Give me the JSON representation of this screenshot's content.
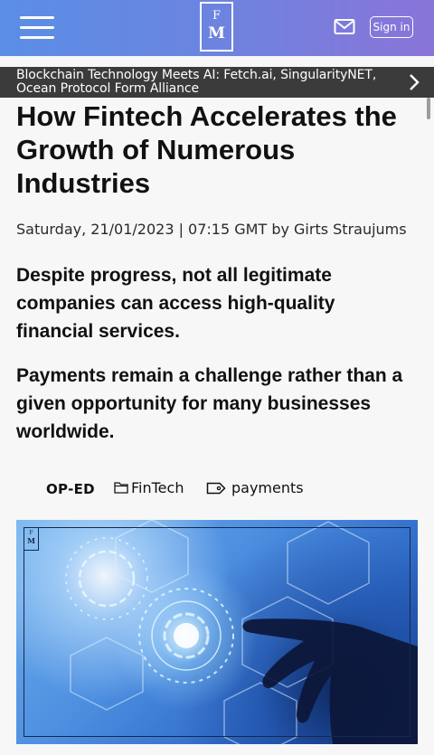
{
  "header": {
    "logo_top": "F",
    "logo_bottom": "M",
    "menu_icon": "hamburger-menu-icon",
    "mail_icon": "mail-icon",
    "signin_label": "Sign in",
    "gradient_colors": [
      "#5b8ee6",
      "#8a74d8"
    ]
  },
  "ticker": {
    "line1": "Blockchain Technology Meets AI: Fetch.ai, SingularityNET,",
    "line2": "Ocean Protocol Form Alliance",
    "chevron_icon": "chevron-right-icon",
    "background": "#3b3b3b"
  },
  "article": {
    "title": "How Fintech Accelerates the Growth of Numerous Industries",
    "byline": "Saturday, 21/01/2023 | 07:15 GMT by Girts Straujums",
    "lead1": "Despite progress, not all legitimate companies can access high-quality financial services.",
    "lead2": "Payments remain a challenge rather than a given opportunity for many businesses worldwide."
  },
  "tags": {
    "category": "OP-ED",
    "folder_icon": "folder-icon",
    "section": "FinTech",
    "tag_icon": "tag-icon",
    "keyword": "payments"
  },
  "hero": {
    "logo_top": "F",
    "logo_bottom": "M"
  }
}
